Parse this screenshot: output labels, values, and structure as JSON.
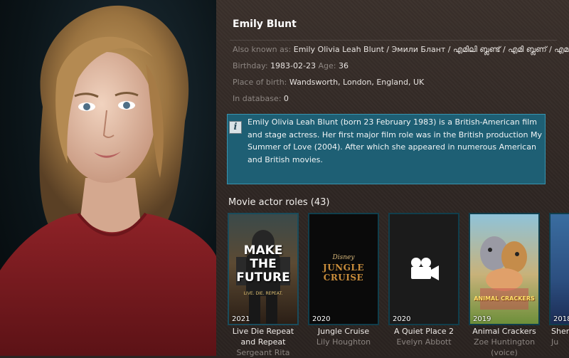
{
  "actor": {
    "name": "Emily Blunt",
    "also_known_label": "Also known as:",
    "also_known_value": "Emily Olivia Leah Blunt  / Эмили Блант / എമിലി ബ്ലണ്ട് / എമി ബ്ലണ് / എമ...",
    "birthday_label": "Birthday:",
    "birthday_value": "1983-02-23",
    "age_label": "Age:",
    "age_value": "36",
    "birthplace_label": "Place of birth:",
    "birthplace_value": "Wandsworth, London, England, UK",
    "in_database_label": "In database:",
    "in_database_value": "0",
    "bio_icon": "info-icon",
    "bio_icon_glyph": "i",
    "bio": "Emily Olivia Leah Blunt (born 23 February 1983) is a British-American film and stage actress. Her first major film role was in the British production My Summer of Love (2004). After which she appeared in numerous American and British movies."
  },
  "roles_section": {
    "title": "Movie actor roles (43)"
  },
  "movies": [
    {
      "year": "2021",
      "title": "Live Die Repeat and Repeat",
      "role": "Sergeant Rita",
      "poster_text": "MAKE THE FUTURE",
      "poster_tagline": "LIVE. DIE. REPEAT."
    },
    {
      "year": "2020",
      "title": "Jungle Cruise",
      "role": "Lily Houghton",
      "poster_brand": "Disney",
      "poster_text": "JUNGLE CRUISE"
    },
    {
      "year": "2020",
      "title": "A Quiet Place 2",
      "role": "Evelyn Abbott",
      "poster_icon": "movie-camera-icon"
    },
    {
      "year": "2019",
      "title": "Animal Crackers",
      "role": "Zoe Huntington (voice)",
      "poster_text": "ANIMAL CRACKERS"
    },
    {
      "year": "2018",
      "title": "Sher",
      "role": "Ju"
    }
  ],
  "colors": {
    "accent": "#1e5f74",
    "accent_border": "#3794b0",
    "panel_bg": "#2e2623"
  }
}
